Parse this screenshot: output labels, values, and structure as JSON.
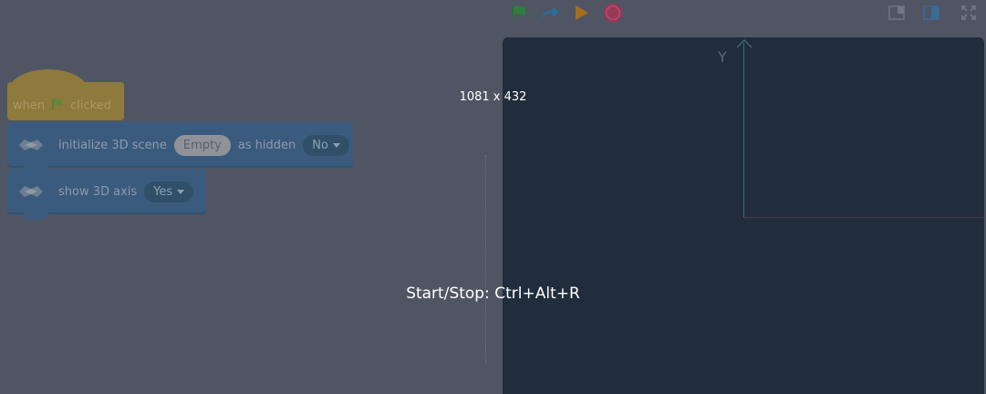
{
  "toolbar": {
    "green_flag": "green-flag-icon",
    "redo": "redo-icon",
    "run": "play-icon",
    "stop": "stop-icon",
    "small_stage": "small-stage-icon",
    "large_stage": "large-stage-icon",
    "fullscreen": "fullscreen-icon"
  },
  "blocks": {
    "hat": {
      "prefix": "when",
      "suffix": "clicked"
    },
    "init": {
      "label": "initialize 3D scene",
      "input": "Empty",
      "mid": "as hidden",
      "option": "No"
    },
    "axis": {
      "label": "show 3D axis",
      "option": "Yes"
    }
  },
  "stage": {
    "y_axis_label": "Y"
  },
  "overlay": {
    "size": "1081 x 432",
    "hotkey": "Start/Stop: Ctrl+Alt+R"
  },
  "colors": {
    "stage_bg": "#212d3c",
    "page_bg": "#4f5563",
    "accent": "#3b5b7e"
  }
}
